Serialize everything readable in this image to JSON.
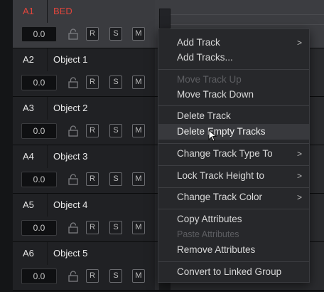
{
  "tracks": [
    {
      "id": "A1",
      "name": "BED",
      "volume": "0.0",
      "r": "R",
      "s": "S",
      "m": "M"
    },
    {
      "id": "A2",
      "name": "Object 1",
      "volume": "0.0",
      "r": "R",
      "s": "S",
      "m": "M"
    },
    {
      "id": "A3",
      "name": "Object 2",
      "volume": "0.0",
      "r": "R",
      "s": "S",
      "m": "M"
    },
    {
      "id": "A4",
      "name": "Object 3",
      "volume": "0.0",
      "r": "R",
      "s": "S",
      "m": "M"
    },
    {
      "id": "A5",
      "name": "Object 4",
      "volume": "0.0",
      "r": "R",
      "s": "S",
      "m": "M"
    },
    {
      "id": "A6",
      "name": "Object 5",
      "volume": "0.0",
      "r": "R",
      "s": "S",
      "m": "M"
    }
  ],
  "menu": {
    "add_track": "Add Track",
    "add_tracks": "Add Tracks...",
    "move_up": "Move Track Up",
    "move_down": "Move Track Down",
    "delete_track": "Delete Track",
    "delete_empty": "Delete Empty Tracks",
    "change_type": "Change Track Type To",
    "lock_height": "Lock Track Height to",
    "change_color": "Change Track Color",
    "copy_attr": "Copy Attributes",
    "paste_attr": "Paste Attributes",
    "remove_attr": "Remove Attributes",
    "convert_linked": "Convert to Linked Group",
    "submenu_glyph": ">"
  },
  "colors": {
    "selected_track_text": "#e2453c",
    "menu_bg": "#27282b",
    "hover_bg": "#38393d"
  }
}
